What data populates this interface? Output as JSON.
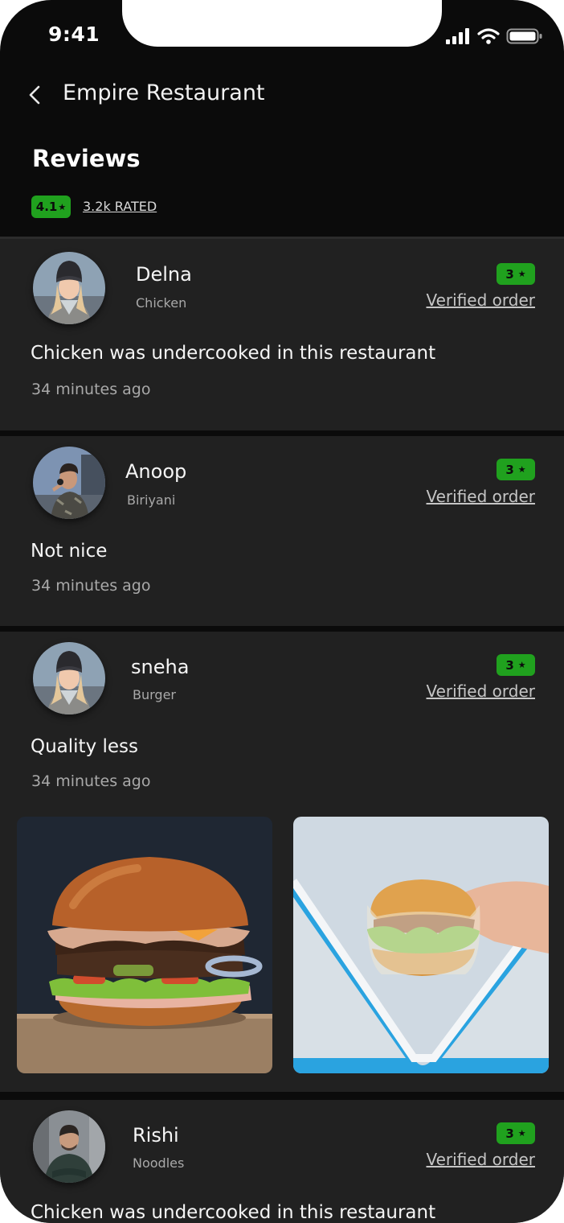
{
  "status_bar": {
    "time": "9:41"
  },
  "header": {
    "title": "Empire Restaurant"
  },
  "summary": {
    "heading": "Reviews",
    "rating": "4.1",
    "rating_star": "★",
    "rated_label": "3.2k RATED"
  },
  "colors": {
    "background": "#0b0b0b",
    "card": "#212121",
    "rating_green": "#20a11e"
  },
  "reviews": [
    {
      "name": "Delna",
      "dish": "Chicken",
      "stars": "3",
      "star": "★",
      "verified": "Verified order",
      "text": "Chicken was undercooked in this restaurant",
      "time": "34 minutes ago"
    },
    {
      "name": "Anoop",
      "dish": "Biriyani",
      "stars": "3",
      "star": "★",
      "verified": "Verified order",
      "text": "Not nice",
      "time": "34 minutes ago"
    },
    {
      "name": "sneha",
      "dish": "Burger",
      "stars": "3",
      "star": "★",
      "verified": "Verified order",
      "text": "Quality less",
      "time": "34 minutes ago"
    },
    {
      "name": "Rishi",
      "dish": "Noodles",
      "stars": "3",
      "star": "★",
      "verified": "Verified order",
      "text": "Chicken was undercooked in this restaurant"
    }
  ]
}
